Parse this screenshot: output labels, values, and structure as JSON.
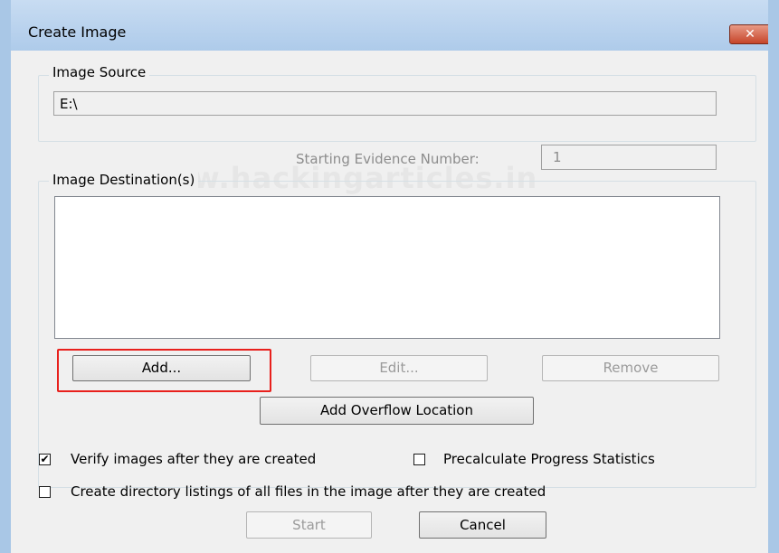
{
  "window": {
    "title": "Create Image",
    "close_glyph": "✕"
  },
  "watermark": "www.hackingarticles.in",
  "image_source": {
    "legend": "Image Source",
    "value": "E:\\"
  },
  "evidence": {
    "label": "Starting Evidence Number:",
    "value": "1"
  },
  "destinations": {
    "legend": "Image Destination(s)",
    "items": [],
    "add_label": "Add...",
    "edit_label": "Edit...",
    "remove_label": "Remove",
    "overflow_label": "Add Overflow Location"
  },
  "options": {
    "verify": {
      "label": "Verify images after they are created",
      "checked": true
    },
    "precalc": {
      "label": "Precalculate Progress Statistics",
      "checked": false
    },
    "listings": {
      "label": "Create directory listings of all files in the image after they are created",
      "checked": false
    }
  },
  "footer": {
    "start_label": "Start",
    "cancel_label": "Cancel"
  },
  "icons": {
    "check": "check-icon",
    "close": "close-icon"
  }
}
